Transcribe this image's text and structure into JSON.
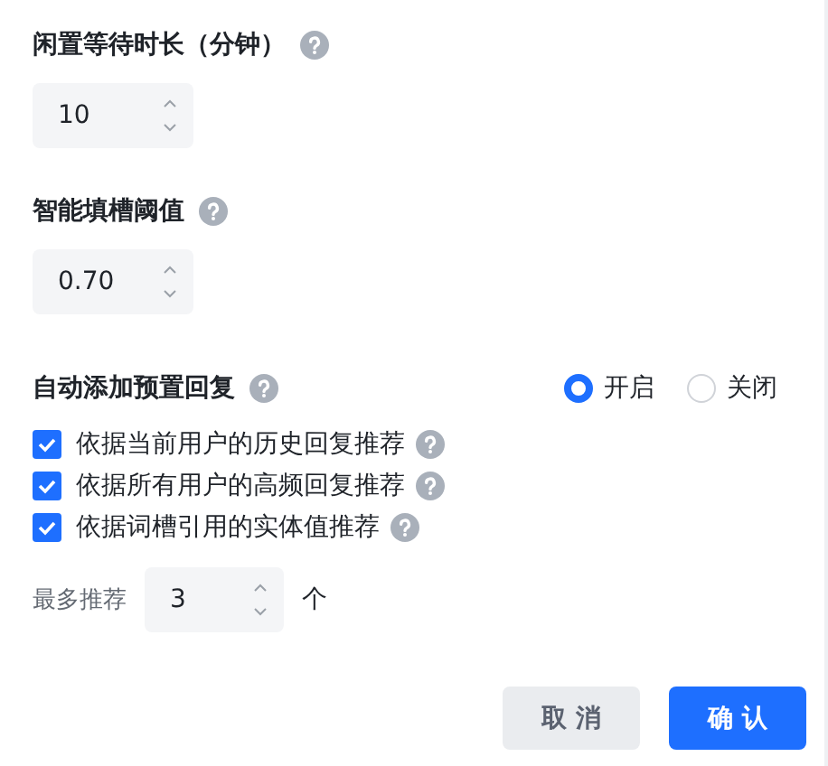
{
  "fields": [
    {
      "label": "闲置等待时长（分钟）",
      "help": true,
      "value": "10"
    },
    {
      "label": "智能填槽阈值",
      "help": true,
      "value": "0.70"
    }
  ],
  "auto_reply": {
    "label": "自动添加预置回复",
    "help": true,
    "options": [
      {
        "label": "开启",
        "selected": true
      },
      {
        "label": "关闭",
        "selected": false
      }
    ],
    "recommendations": [
      {
        "label": "依据当前用户的历史回复推荐",
        "checked": true,
        "help": true
      },
      {
        "label": "依据所有用户的高频回复推荐",
        "checked": true,
        "help": true
      },
      {
        "label": "依据词槽引用的实体值推荐",
        "checked": true,
        "help": true
      }
    ],
    "max": {
      "label": "最多推荐",
      "value": "3",
      "unit": "个"
    }
  },
  "buttons": [
    {
      "label": "取 消",
      "kind": "secondary"
    },
    {
      "label": "确 认",
      "kind": "primary"
    }
  ]
}
